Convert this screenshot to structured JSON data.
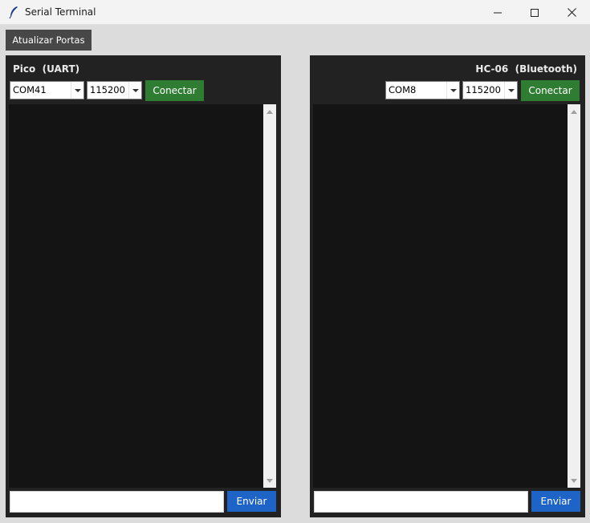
{
  "window": {
    "title": "Serial Terminal",
    "icon": "feather-icon"
  },
  "toolbar": {
    "refresh_label": "Atualizar Portas"
  },
  "panels": {
    "pico": {
      "title": "Pico  (UART)",
      "port": "COM41",
      "baud": "115200",
      "connect_label": "Conectar",
      "send_label": "Enviar",
      "input_value": ""
    },
    "hc06": {
      "title": "HC-06  (Bluetooth)",
      "port": "COM8",
      "baud": "115200",
      "connect_label": "Conectar",
      "send_label": "Enviar",
      "input_value": ""
    }
  },
  "colors": {
    "panel_bg": "#222222",
    "console_bg": "#141414",
    "connect_green": "#2e7d32",
    "send_blue": "#1e63c6",
    "refresh_gray": "#474747"
  }
}
